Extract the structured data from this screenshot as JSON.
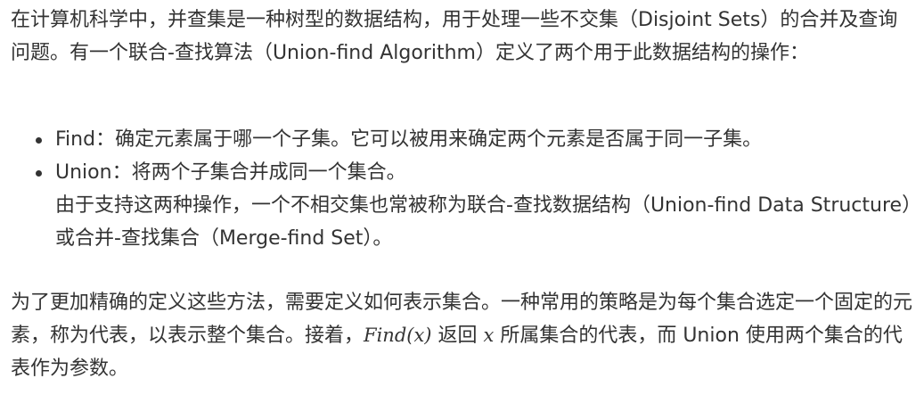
{
  "intro": {
    "text": "在计算机科学中，并查集是一种树型的数据结构，用于处理一些不交集（Disjoint Sets）的合并及查询问题。有一个联合-查找算法（Union-find Algorithm）定义了两个用于此数据结构的操作："
  },
  "operations": [
    {
      "name": "Find",
      "description": "：确定元素属于哪一个子集。它可以被用来确定两个元素是否属于同一子集。"
    },
    {
      "name": "Union",
      "description": "：将两个子集合并成同一个集合。",
      "note": "由于支持这两种操作，一个不相交集也常被称为联合-查找数据结构（Union-find Data Structure）或合并-查找集合（Merge-find Set）。"
    }
  ],
  "definition": {
    "text_before": "为了更加精确的定义这些方法，需要定义如何表示集合。一种常用的策略是为每个集合选定一个固定的元素，称为代表，以表示整个集合。接着，",
    "math_find": "Find(x)",
    "text_middle": " 返回 ",
    "math_x": "x",
    "text_after": " 所属集合的代表，而 Union 使用两个集合的代表作为参数。"
  }
}
